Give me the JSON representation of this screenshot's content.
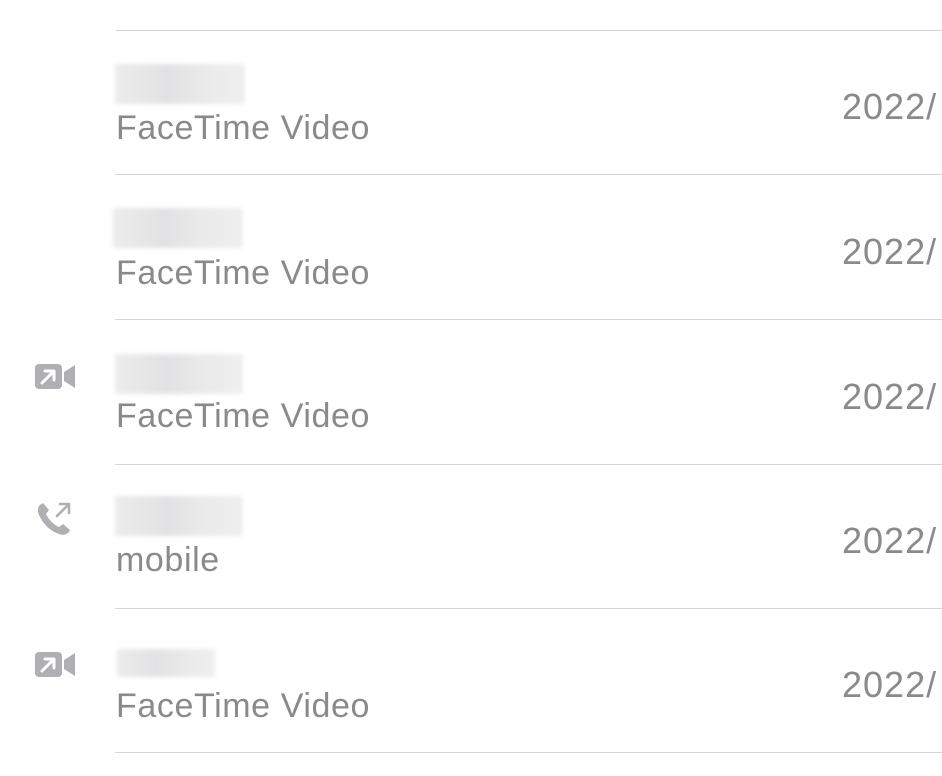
{
  "call_log": {
    "top_partial_text": "",
    "rows": [
      {
        "label": "FaceTime Video",
        "date": "2022/",
        "icon": "none"
      },
      {
        "label": "FaceTime Video",
        "date": "2022/",
        "icon": "none"
      },
      {
        "label": "FaceTime Video",
        "date": "2022/",
        "icon": "outgoing-facetime-video-icon"
      },
      {
        "label": "mobile",
        "date": "2022/",
        "icon": "outgoing-phone-call-icon"
      },
      {
        "label": "FaceTime Video",
        "date": "2022/",
        "icon": "outgoing-facetime-video-icon"
      }
    ]
  },
  "colors": {
    "secondary_text": "#8a8a8e",
    "icon": "#b0b0b4",
    "separator": "#d6d6d8",
    "background": "#ffffff"
  }
}
